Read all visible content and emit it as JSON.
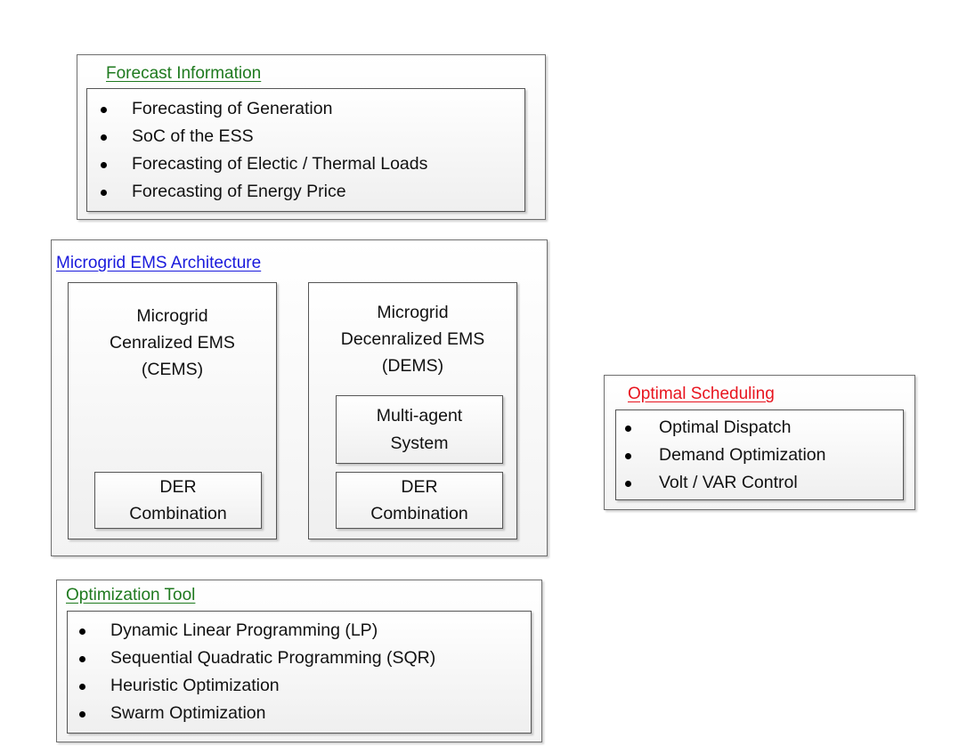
{
  "forecast": {
    "title": "Forecast Information",
    "items": [
      "Forecasting of Generation",
      "SoC of the ESS",
      "Forecasting of Electic / Thermal Loads",
      "Forecasting of Energy Price"
    ]
  },
  "architecture": {
    "title": "Microgrid EMS Architecture",
    "centralized": {
      "lines": [
        "Microgrid",
        "Cenralized EMS",
        "(CEMS)"
      ],
      "der": [
        "DER",
        "Combination"
      ]
    },
    "decentralized": {
      "lines": [
        "Microgrid",
        "Decenralized EMS",
        "(DEMS)"
      ],
      "multi_agent": [
        "Multi-agent",
        "System"
      ],
      "der": [
        "DER",
        "Combination"
      ]
    }
  },
  "scheduling": {
    "title": "Optimal Scheduling",
    "items": [
      "Optimal Dispatch",
      "Demand Optimization",
      "Volt / VAR Control"
    ]
  },
  "optimization": {
    "title": "Optimization Tool",
    "items": [
      "Dynamic Linear Programming (LP)",
      "Sequential Quadratic Programming (SQR)",
      "Heuristic Optimization",
      "Swarm Optimization"
    ]
  }
}
